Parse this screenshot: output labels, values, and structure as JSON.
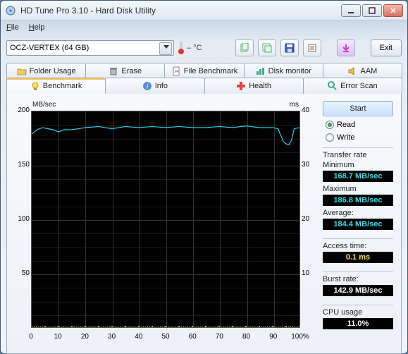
{
  "window": {
    "title": "HD Tune Pro 3.10 - Hard Disk Utility"
  },
  "menu": {
    "file": "File",
    "help": "Help"
  },
  "toolbar": {
    "drive": "OCZ-VERTEX (64 GB)",
    "temp_label": "– °C",
    "exit": "Exit"
  },
  "tabs_top": [
    {
      "label": "Folder Usage"
    },
    {
      "label": "Erase"
    },
    {
      "label": "File Benchmark"
    },
    {
      "label": "Disk monitor"
    },
    {
      "label": "AAM"
    }
  ],
  "tabs_bottom": [
    {
      "label": "Benchmark",
      "active": true
    },
    {
      "label": "Info"
    },
    {
      "label": "Health"
    },
    {
      "label": "Error Scan"
    }
  ],
  "chart_data": {
    "type": "line",
    "xlabel": "",
    "ylabel_left": "MB/sec",
    "ylabel_right": "ms",
    "x_ticks": [
      0,
      10,
      20,
      30,
      40,
      50,
      60,
      70,
      80,
      90,
      100
    ],
    "x_tick_labels": [
      "0",
      "10",
      "20",
      "30",
      "40",
      "50",
      "60",
      "70",
      "80",
      "90",
      "100%"
    ],
    "y_left_ticks": [
      50,
      100,
      150,
      200
    ],
    "y_right_ticks": [
      10,
      20,
      30,
      40
    ],
    "ylim_left": [
      0,
      200
    ],
    "ylim_right": [
      0,
      40
    ],
    "series": [
      {
        "name": "Transfer rate (MB/sec)",
        "axis": "left",
        "color": "#26d1e8",
        "x": [
          0,
          2,
          4,
          6,
          8,
          10,
          12,
          15,
          20,
          25,
          30,
          35,
          40,
          45,
          50,
          55,
          60,
          65,
          70,
          75,
          80,
          85,
          88,
          90,
          92,
          93,
          94,
          95,
          96,
          97,
          98,
          100
        ],
        "y": [
          179,
          183,
          185,
          184,
          183,
          181,
          183,
          183,
          185,
          186,
          184,
          186,
          185,
          186,
          185,
          186,
          185,
          185,
          186,
          185,
          186.5,
          185,
          185,
          185,
          184,
          178,
          172,
          170,
          169,
          173,
          184,
          185
        ]
      },
      {
        "name": "Access time (ms)",
        "axis": "right",
        "color": "#f2e230",
        "style": "dots",
        "x": [
          0,
          5,
          10,
          15,
          20,
          25,
          30,
          35,
          40,
          45,
          50,
          55,
          60,
          65,
          70,
          75,
          80,
          85,
          90,
          95,
          100
        ],
        "y": [
          0.1,
          0.1,
          0.1,
          0.1,
          0.1,
          0.1,
          0.1,
          0.1,
          0.1,
          0.1,
          0.1,
          0.1,
          0.1,
          0.1,
          0.1,
          0.1,
          0.1,
          0.1,
          0.1,
          0.1,
          0.1
        ]
      }
    ]
  },
  "panel": {
    "start": "Start",
    "read": "Read",
    "write": "Write",
    "transfer_label": "Transfer rate",
    "min_label": "Minimum",
    "min_value": "168.7 MB/sec",
    "max_label": "Maximum",
    "max_value": "186.8 MB/sec",
    "avg_label": "Average:",
    "avg_value": "184.4 MB/sec",
    "access_label": "Access time:",
    "access_value": "0.1 ms",
    "burst_label": "Burst rate:",
    "burst_value": "142.9 MB/sec",
    "cpu_label": "CPU usage",
    "cpu_value": "11.0%"
  }
}
